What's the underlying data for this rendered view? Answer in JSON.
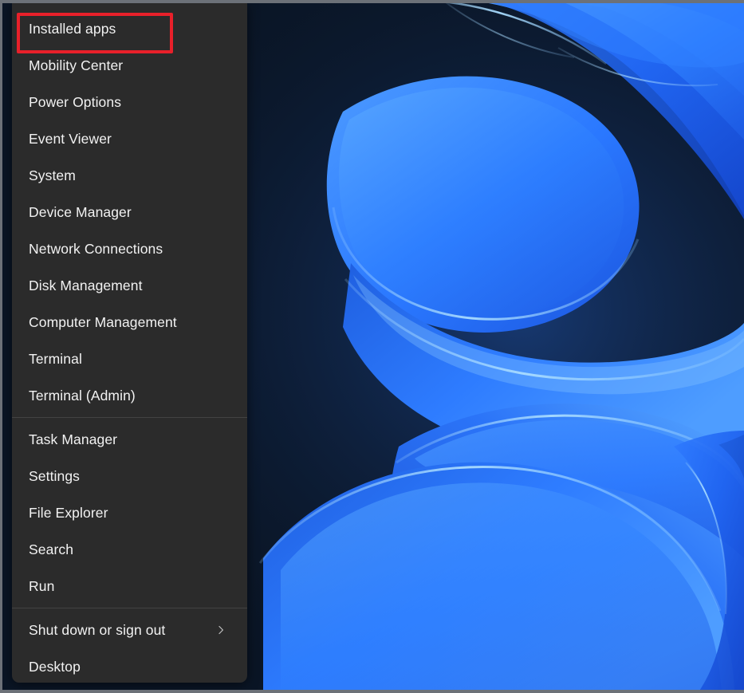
{
  "desktop": {
    "wallpaper_name": "windows-11-bloom-wallpaper",
    "background_color": "#0b1626",
    "accent_color": "#2b7fff"
  },
  "menu": {
    "name": "Power User Menu (Win+X)",
    "background_color": "#2b2b2b",
    "text_color": "#f2f2f2",
    "groups": [
      {
        "items": [
          {
            "label": "Installed apps",
            "submenu": false,
            "highlighted": true
          },
          {
            "label": "Mobility Center",
            "submenu": false,
            "highlighted": false
          },
          {
            "label": "Power Options",
            "submenu": false,
            "highlighted": false
          },
          {
            "label": "Event Viewer",
            "submenu": false,
            "highlighted": false
          },
          {
            "label": "System",
            "submenu": false,
            "highlighted": false
          },
          {
            "label": "Device Manager",
            "submenu": false,
            "highlighted": false
          },
          {
            "label": "Network Connections",
            "submenu": false,
            "highlighted": false
          },
          {
            "label": "Disk Management",
            "submenu": false,
            "highlighted": false
          },
          {
            "label": "Computer Management",
            "submenu": false,
            "highlighted": false
          },
          {
            "label": "Terminal",
            "submenu": false,
            "highlighted": false
          },
          {
            "label": "Terminal (Admin)",
            "submenu": false,
            "highlighted": false
          }
        ]
      },
      {
        "items": [
          {
            "label": "Task Manager",
            "submenu": false,
            "highlighted": false
          },
          {
            "label": "Settings",
            "submenu": false,
            "highlighted": false
          },
          {
            "label": "File Explorer",
            "submenu": false,
            "highlighted": false
          },
          {
            "label": "Search",
            "submenu": false,
            "highlighted": false
          },
          {
            "label": "Run",
            "submenu": false,
            "highlighted": false
          }
        ]
      },
      {
        "items": [
          {
            "label": "Shut down or sign out",
            "submenu": true,
            "highlighted": false
          },
          {
            "label": "Desktop",
            "submenu": false,
            "highlighted": false
          }
        ]
      }
    ]
  },
  "annotation": {
    "highlight_color": "#e8202a",
    "highlight_target": "Installed apps",
    "border_width_px": 4
  }
}
